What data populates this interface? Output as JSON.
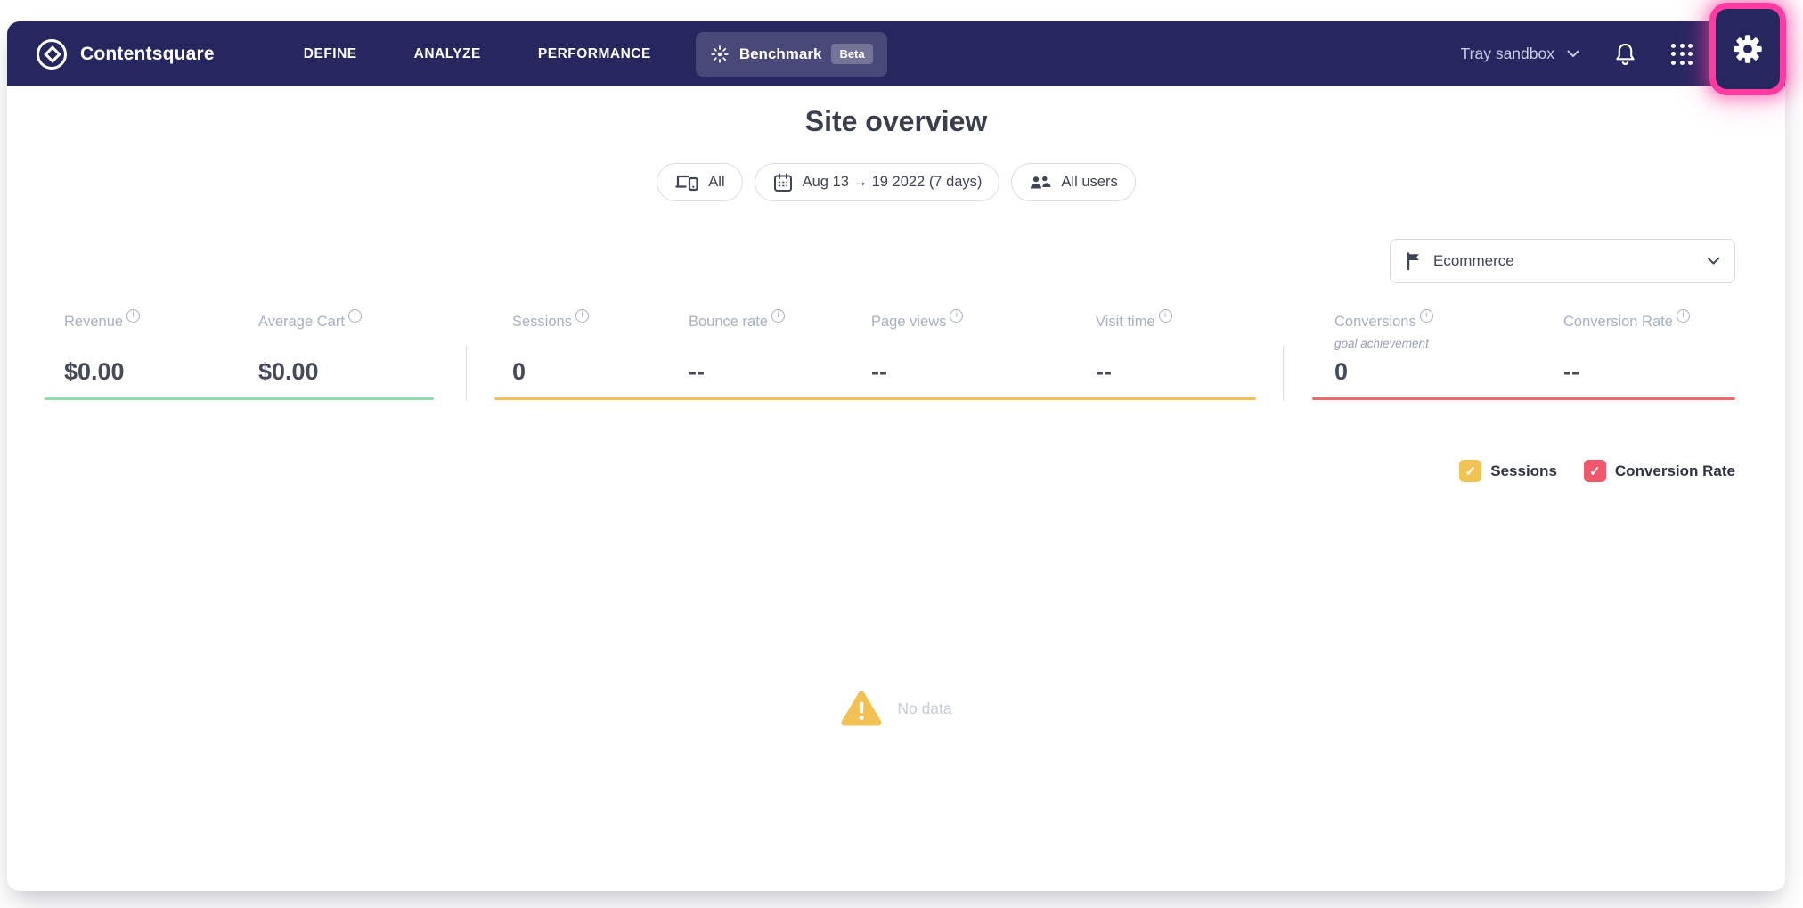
{
  "nav": {
    "brand": "Contentsquare",
    "menu": [
      "DEFINE",
      "ANALYZE",
      "PERFORMANCE"
    ],
    "benchmark": {
      "label": "Benchmark",
      "badge": "Beta"
    },
    "account": "Tray sandbox"
  },
  "header": {
    "title": "Site overview"
  },
  "filters": {
    "device": "All",
    "date_range": "Aug 13 → 19 2022 (7 days)",
    "audience": "All users"
  },
  "mapping_dropdown": {
    "value": "Ecommerce"
  },
  "metrics": {
    "groups": [
      {
        "name": "revenue",
        "accent": "#93dcae",
        "items": [
          {
            "label": "Revenue",
            "value": "$0.00"
          },
          {
            "label": "Average Cart",
            "value": "$0.00"
          }
        ]
      },
      {
        "name": "traffic",
        "accent": "#f2c05a",
        "items": [
          {
            "label": "Sessions",
            "value": "0"
          },
          {
            "label": "Bounce rate",
            "value": "--"
          },
          {
            "label": "Page views",
            "value": "--"
          },
          {
            "label": "Visit time",
            "value": "--"
          }
        ]
      },
      {
        "name": "conversion",
        "accent": "#ef6a6a",
        "items": [
          {
            "label": "Conversions",
            "sublabel": "goal achievement",
            "value": "0"
          },
          {
            "label": "Conversion Rate",
            "value": "--"
          }
        ]
      }
    ]
  },
  "chart": {
    "legend": [
      {
        "label": "Sessions",
        "color": "#f0c354",
        "checked": true
      },
      {
        "label": "Conversion Rate",
        "color": "#f0596b",
        "checked": true
      }
    ],
    "empty_state": "No data"
  },
  "colors": {
    "nav_navy": "#272760",
    "highlight_pink": "#ff3aa0",
    "warning_amber": "#f2c053"
  }
}
